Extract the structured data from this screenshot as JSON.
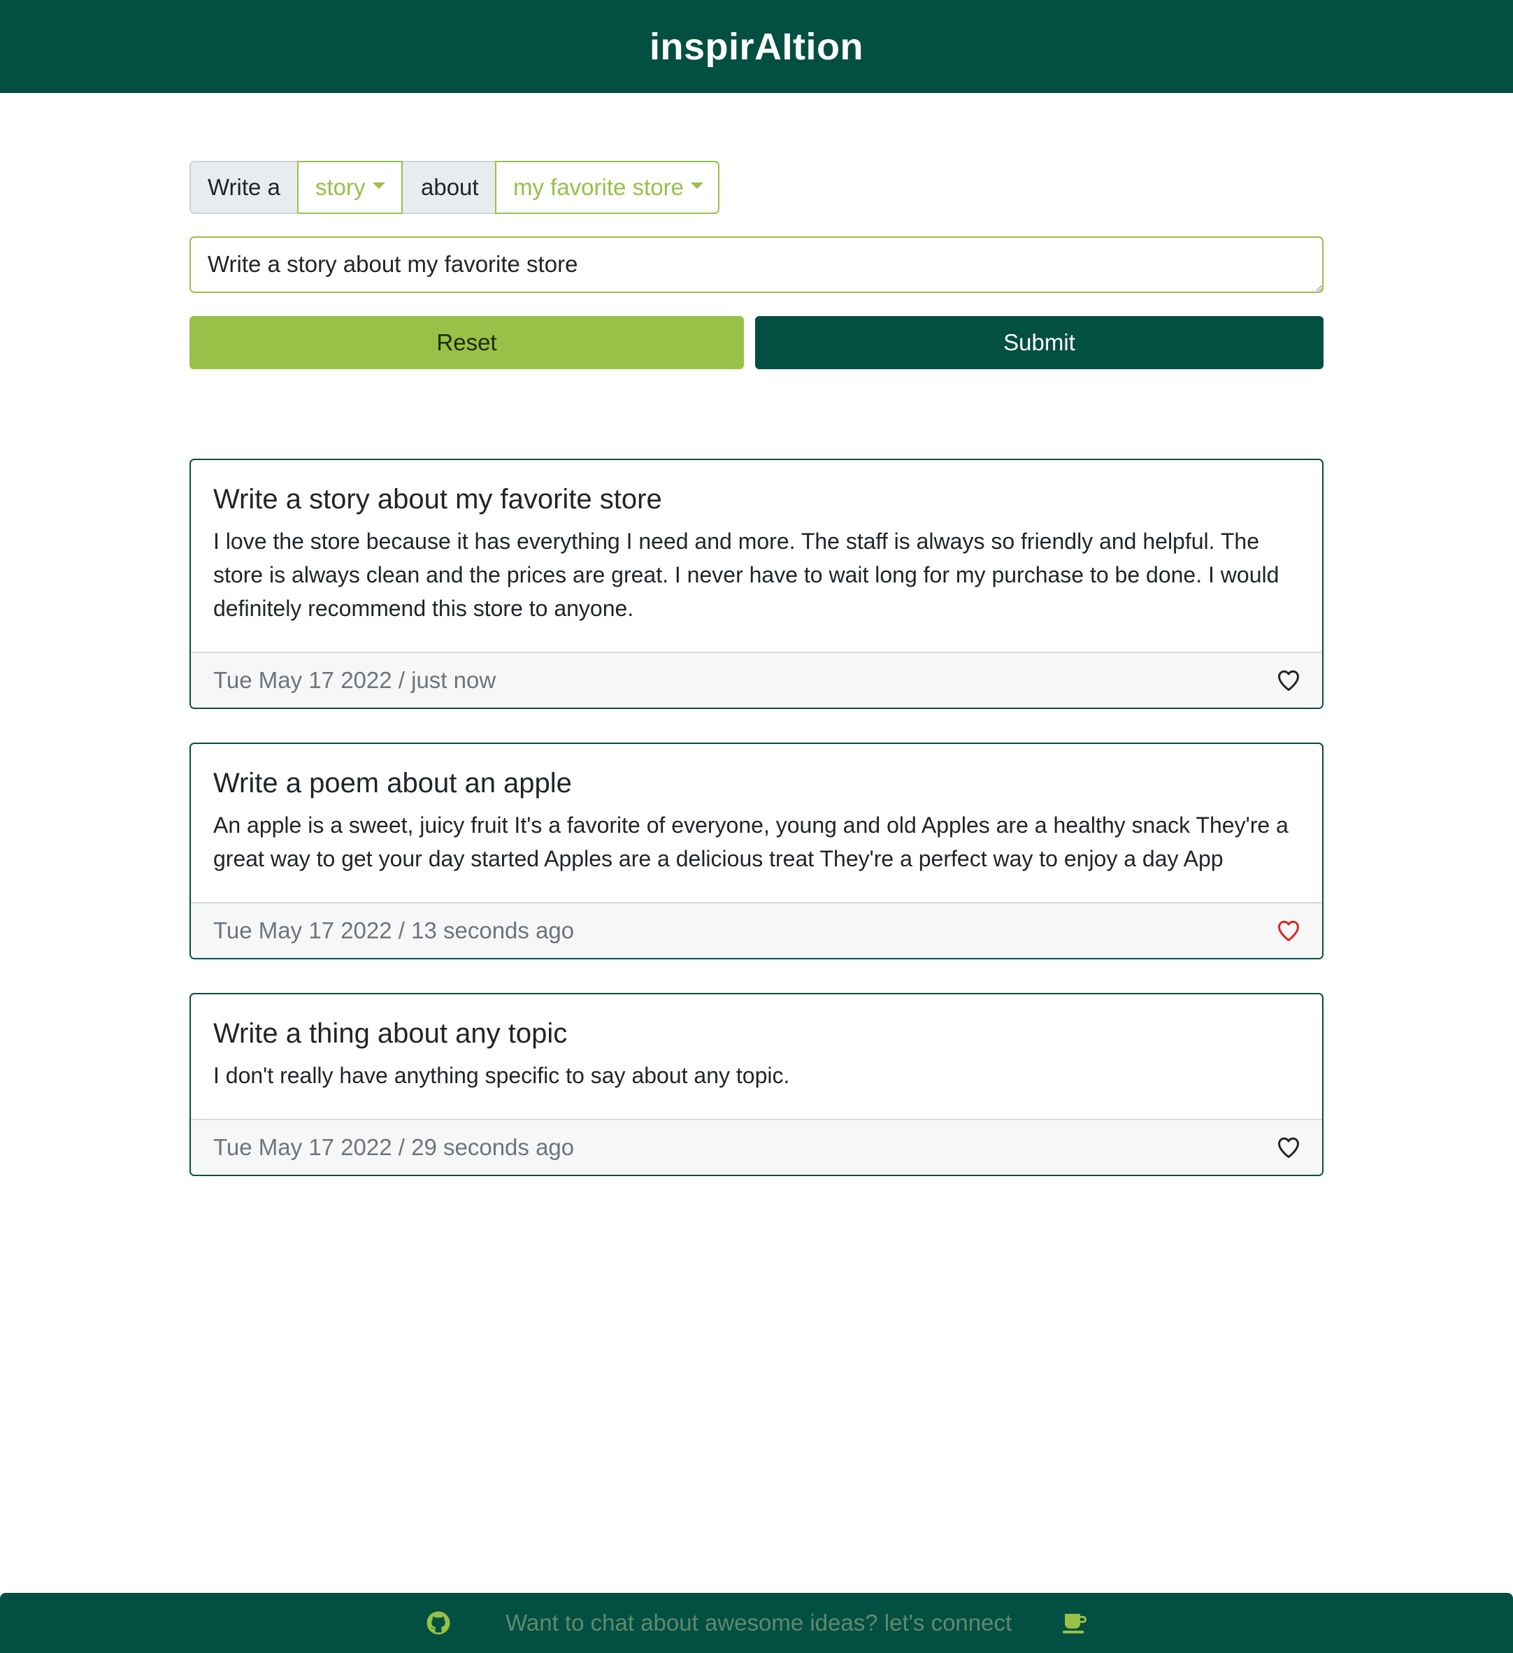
{
  "app": {
    "title": "inspirAItion"
  },
  "prompt_builder": {
    "prefix_label": "Write a",
    "type_selected": "story",
    "connector_label": "about",
    "topic_selected": "my favorite store"
  },
  "prompt_input": {
    "value": "Write a story about my favorite store"
  },
  "actions": {
    "reset_label": "Reset",
    "submit_label": "Submit"
  },
  "results": [
    {
      "title": "Write a story about my favorite store",
      "text": "I love the store because it has everything I need and more. The staff is always so friendly and helpful. The store is always clean and the prices are great. I never have to wait long for my purchase to be done. I would definitely recommend this store to anyone.",
      "date": "Tue May 17 2022 / just now",
      "liked": false,
      "heart_icon": "heart-outline-icon"
    },
    {
      "title": "Write a poem about an apple",
      "text": "An apple is a sweet, juicy fruit It's a favorite of everyone, young and old Apples are a healthy snack They're a great way to get your day started Apples are a delicious treat They're a perfect way to enjoy a day App",
      "date": "Tue May 17 2022 / 13 seconds ago",
      "liked": true,
      "heart_icon": "heart-outline-icon"
    },
    {
      "title": "Write a thing about any topic",
      "text": "I don't really have anything specific to say about any topic.",
      "date": "Tue May 17 2022 / 29 seconds ago",
      "liked": false,
      "heart_icon": "heart-outline-icon"
    }
  ],
  "footer": {
    "text": "Want to chat about awesome ideas? let's connect",
    "left_icon": "github-icon",
    "right_icon": "coffee-cup-icon"
  },
  "colors": {
    "brand_dark": "#034f41",
    "brand_accent": "#97c147",
    "heart_liked": "#e02424",
    "heart_default": "#212529"
  }
}
